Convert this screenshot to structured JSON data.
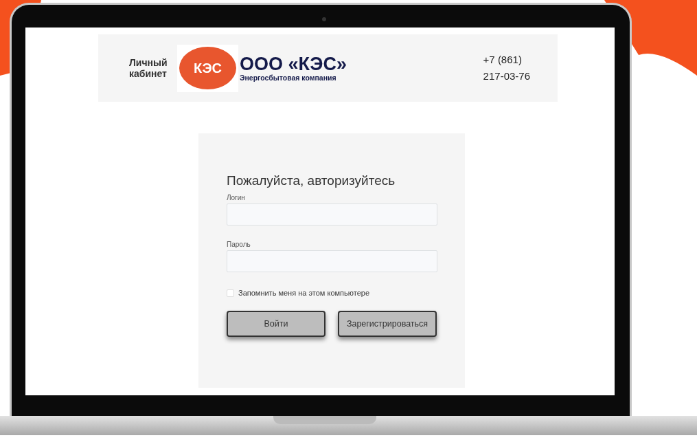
{
  "header": {
    "cabinet_label": "Личный кабинет",
    "logo_text": "КЭС",
    "company_name": "ООО «КЭС»",
    "company_subtitle": "Энергосбытовая компания",
    "phone_lines": [
      "+7 (861)",
      "217-03-76"
    ]
  },
  "login_form": {
    "title": "Пожалуйста, авторизуйтесь",
    "fields": [
      {
        "label": "Логин"
      },
      {
        "label": "Пароль"
      }
    ],
    "remember": {
      "label": "Запомнить меня на этом компьютере",
      "checked": false
    },
    "buttons": [
      "Войти",
      "Зарегистрироваться"
    ]
  }
}
